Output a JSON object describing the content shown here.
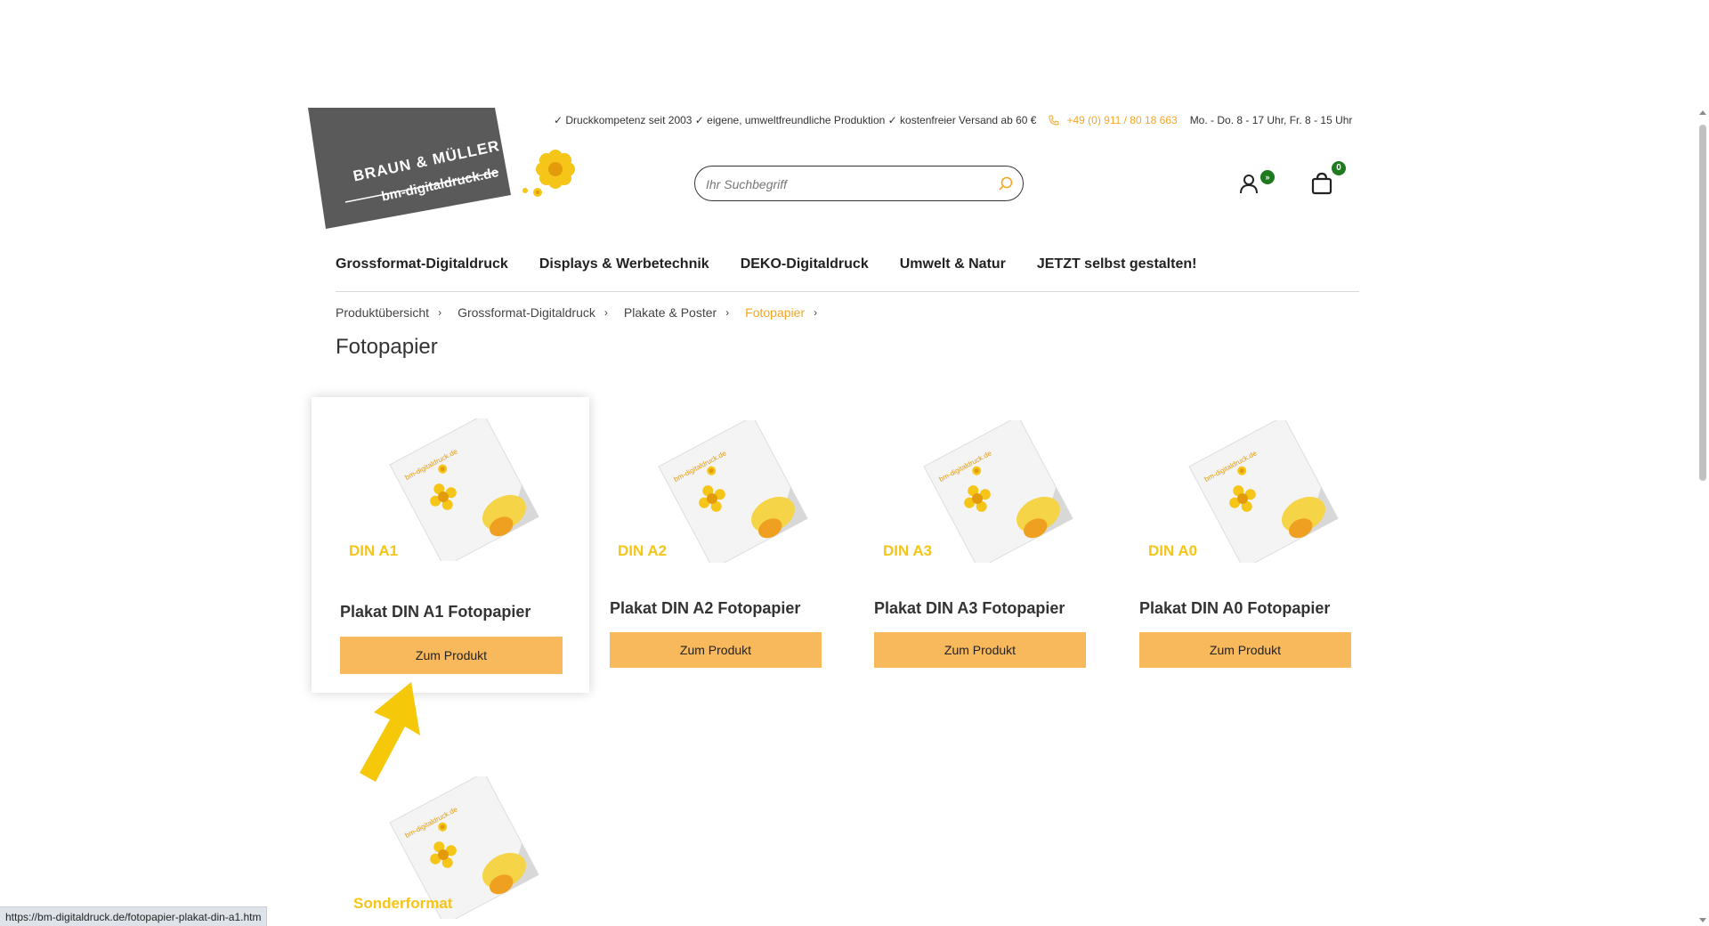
{
  "header": {
    "logo_line1": "BRAUN & MÜLLER",
    "logo_line2": "bm-digitaldruck.de",
    "topbar_text": "✓ Druckkompetenz seit 2003 ✓ eigene, umweltfreundliche Produktion ✓ kostenfreier Versand ab 60 €",
    "phone": "+49 (0) 911 / 80 18 663",
    "hours": "Mo. - Do. 8 - 17 Uhr, Fr. 8 - 15 Uhr",
    "search_placeholder": "Ihr Suchbegriff",
    "user_badge": "»",
    "cart_count": "0"
  },
  "nav": [
    {
      "label": "Grossformat-Digitaldruck"
    },
    {
      "label": "Displays & Werbetechnik"
    },
    {
      "label": "DEKO-Digitaldruck"
    },
    {
      "label": "Umwelt & Natur"
    },
    {
      "label": "JETZT selbst gestalten!"
    }
  ],
  "breadcrumb": [
    {
      "label": "Produktübersicht"
    },
    {
      "label": "Grossformat-Digitaldruck"
    },
    {
      "label": "Plakate & Poster"
    },
    {
      "label": "Fotopapier"
    }
  ],
  "page_title": "Fotopapier",
  "products": [
    {
      "size_label": "DIN A1",
      "title": "Plakat DIN A1 Fotopapier",
      "button": "Zum Produkt",
      "image_text": "bm-digitaldruck.de"
    },
    {
      "size_label": "DIN A2",
      "title": "Plakat DIN A2 Fotopapier",
      "button": "Zum Produkt",
      "image_text": "bm-digitaldruck.de"
    },
    {
      "size_label": "DIN A3",
      "title": "Plakat DIN A3 Fotopapier",
      "button": "Zum Produkt",
      "image_text": "bm-digitaldruck.de"
    },
    {
      "size_label": "DIN A0",
      "title": "Plakat DIN A0 Fotopapier",
      "button": "Zum Produkt",
      "image_text": "bm-digitaldruck.de"
    },
    {
      "size_label": "Sonderformat",
      "image_text": "bm-digitaldruck.de"
    }
  ],
  "status_url": "https://bm-digitaldruck.de/fotopapier-plakat-din-a1.htm",
  "colors": {
    "accent": "#f5a623",
    "button": "#f8b95c",
    "badge": "#1f7a1f",
    "logo": "#5a5a5a"
  }
}
